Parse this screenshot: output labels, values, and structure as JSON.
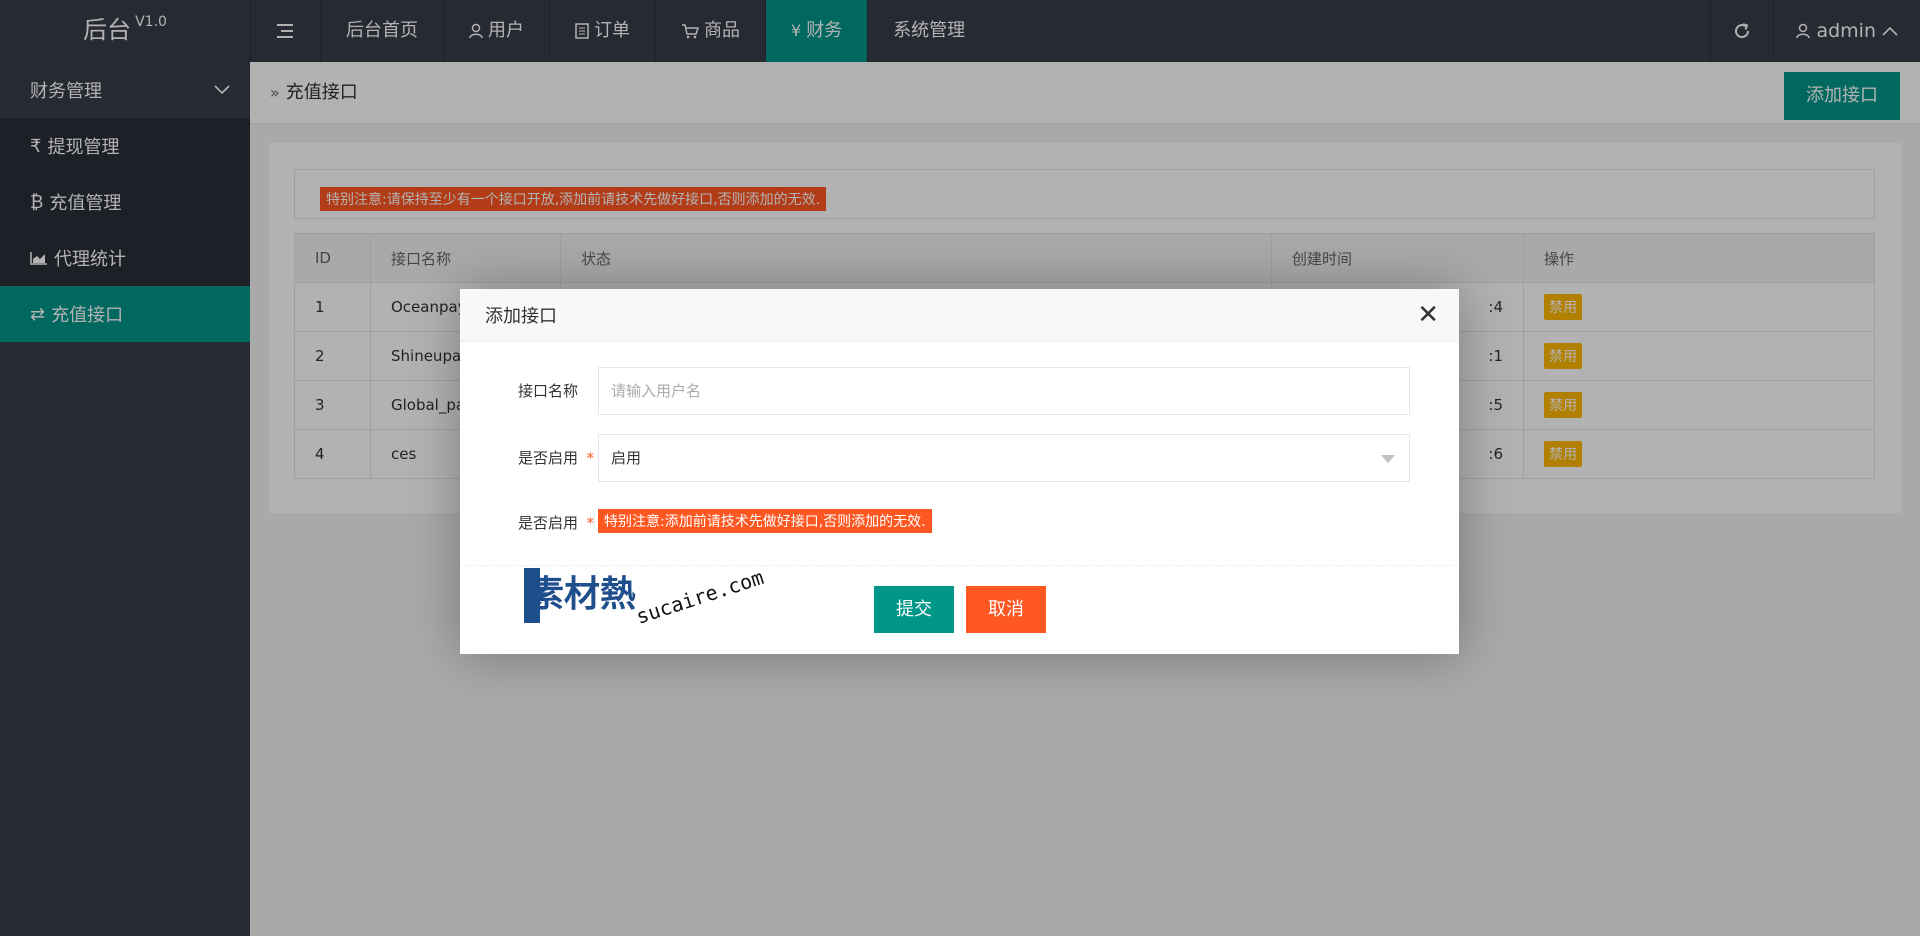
{
  "header": {
    "logo": "后台",
    "version": "V1.0",
    "menu_icon": "menu-icon",
    "nav": [
      {
        "label": "后台首页",
        "icon": ""
      },
      {
        "label": "用户",
        "icon": "user-icon"
      },
      {
        "label": "订单",
        "icon": "document-icon"
      },
      {
        "label": "商品",
        "icon": "cart-icon"
      },
      {
        "label": "财务",
        "icon": "yen-icon",
        "active": true
      },
      {
        "label": "系统管理",
        "icon": ""
      }
    ],
    "refresh_icon": "refresh-icon",
    "user": "admin"
  },
  "sidebar": {
    "group": "财务管理",
    "items": [
      {
        "label": "提现管理",
        "icon": "rupee-icon"
      },
      {
        "label": "充值管理",
        "icon": "bitcoin-icon"
      },
      {
        "label": "代理统计",
        "icon": "area-chart-icon"
      },
      {
        "label": "充值接口",
        "icon": "exchange-icon",
        "active": true
      }
    ]
  },
  "main": {
    "breadcrumb": "充值接口",
    "add_button": "添加接口",
    "notice": "特别注意:请保持至少有一个接口开放,添加前请技术先做好接口,否则添加的无效.",
    "table": {
      "headers": [
        "ID",
        "接口名称",
        "状态",
        "创建时间",
        "操作"
      ],
      "rows": [
        {
          "id": "1",
          "name": "Oceanpay",
          "time_tail": ":4",
          "action": "禁用"
        },
        {
          "id": "2",
          "name": "Shineupay",
          "time_tail": ":1",
          "action": "禁用"
        },
        {
          "id": "3",
          "name": "Global_pa",
          "time_tail": ":5",
          "action": "禁用"
        },
        {
          "id": "4",
          "name": "ces",
          "time_tail": ":6",
          "action": "禁用"
        }
      ]
    }
  },
  "modal": {
    "title": "添加接口",
    "name_label": "接口名称",
    "name_placeholder": "请输入用户名",
    "enable_label": "是否启用",
    "enable_value": "启用",
    "note_label": "是否启用",
    "note_text": "特别注意:添加前请技术先做好接口,否则添加的无效.",
    "submit": "提交",
    "cancel": "取消",
    "watermark_cn": "素材熱",
    "watermark_en": "sucaire.com"
  },
  "colors": {
    "primary": "#009688",
    "danger": "#ff5722",
    "warn": "#ffb800",
    "dark": "#393d49"
  }
}
